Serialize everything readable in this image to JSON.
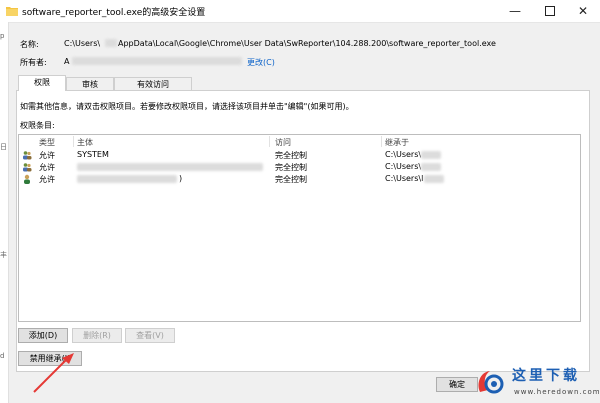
{
  "window": {
    "title": "software_reporter_tool.exe的高级安全设置",
    "minimize_icon": "minimize-icon",
    "maximize_icon": "maximize-icon",
    "close_icon": "close-icon"
  },
  "left_edge": {
    "glyphs": [
      "p",
      "日",
      "丰",
      "d"
    ]
  },
  "properties": {
    "name_label": "名称:",
    "name_prefix": "C:\\Users\\",
    "name_suffix": "AppData\\Local\\Google\\Chrome\\User Data\\SwReporter\\104.288.200\\software_reporter_tool.exe",
    "owner_label": "所有者:",
    "owner_prefix": "A",
    "owner_change_link": "更改(C)"
  },
  "tabs": [
    {
      "label": "权限",
      "active": true
    },
    {
      "label": "审核",
      "active": false
    },
    {
      "label": "有效访问",
      "active": false
    }
  ],
  "info_text": "如需其他信息，请双击权限项目。若要修改权限项目，请选择该项目并单击\"编辑\"(如果可用)。",
  "entries_label": "权限条目:",
  "columns": {
    "type": "类型",
    "principal": "主体",
    "access": "访问",
    "inherited": "继承于"
  },
  "rows": [
    {
      "type": "允许",
      "principal": "SYSTEM",
      "access": "完全控制",
      "inherited": "C:\\Users\\",
      "icon": "users-icon"
    },
    {
      "type": "允许",
      "principal": "",
      "access": "完全控制",
      "inherited": "C:\\Users\\",
      "icon": "users-icon"
    },
    {
      "type": "允许",
      "principal": ")",
      "access": "完全控制",
      "inherited": "C:\\Users\\l",
      "icon": "user-icon"
    }
  ],
  "buttons": {
    "add": "添加(D)",
    "remove": "删除(R)",
    "view": "查看(V)",
    "disable_inheritance": "禁用继承(I)",
    "ok": "确定"
  },
  "watermark": {
    "brand": "这里下载",
    "url": "www.heredown.com"
  }
}
